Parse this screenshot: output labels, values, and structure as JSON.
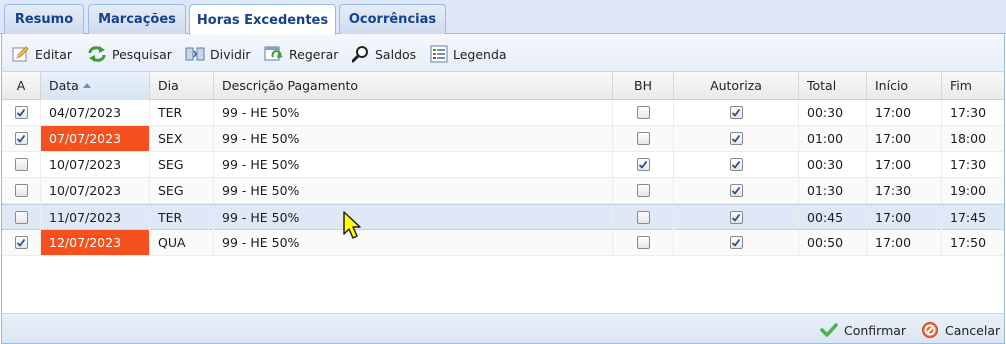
{
  "tabs": [
    {
      "label": "Resumo"
    },
    {
      "label": "Marcações"
    },
    {
      "label": "Horas Excedentes"
    },
    {
      "label": "Ocorrências"
    }
  ],
  "toolbar": {
    "editar": "Editar",
    "pesquisar": "Pesquisar",
    "dividir": "Dividir",
    "regerar": "Regerar",
    "saldos": "Saldos",
    "legenda": "Legenda"
  },
  "grid": {
    "columns": {
      "a": "A",
      "data": "Data",
      "dia": "Dia",
      "descricao": "Descrição Pagamento",
      "bh": "BH",
      "autoriza": "Autoriza",
      "total": "Total",
      "inicio": "Início",
      "fim": "Fim"
    },
    "rows": [
      {
        "a": true,
        "data": "04/07/2023",
        "highlight": false,
        "dia": "TER",
        "descricao": "99 - HE 50%",
        "bh": false,
        "autoriza": true,
        "total": "00:30",
        "inicio": "17:00",
        "fim": "17:30"
      },
      {
        "a": true,
        "data": "07/07/2023",
        "highlight": true,
        "dia": "SEX",
        "descricao": "99 - HE 50%",
        "bh": false,
        "autoriza": true,
        "total": "01:00",
        "inicio": "17:00",
        "fim": "18:00"
      },
      {
        "a": false,
        "data": "10/07/2023",
        "highlight": false,
        "dia": "SEG",
        "descricao": "99 - HE 50%",
        "bh": true,
        "autoriza": true,
        "total": "00:30",
        "inicio": "17:00",
        "fim": "17:30"
      },
      {
        "a": false,
        "data": "10/07/2023",
        "highlight": false,
        "dia": "SEG",
        "descricao": "99 - HE 50%",
        "bh": false,
        "autoriza": true,
        "total": "01:30",
        "inicio": "17:30",
        "fim": "19:00"
      },
      {
        "a": false,
        "data": "11/07/2023",
        "highlight": false,
        "dia": "TER",
        "descricao": "99 - HE 50%",
        "bh": false,
        "autoriza": true,
        "total": "00:45",
        "inicio": "17:00",
        "fim": "17:45"
      },
      {
        "a": true,
        "data": "12/07/2023",
        "highlight": true,
        "dia": "QUA",
        "descricao": "99 - HE 50%",
        "bh": false,
        "autoriza": true,
        "total": "00:50",
        "inicio": "17:00",
        "fim": "17:50"
      }
    ],
    "selected_row": 4
  },
  "footer": {
    "confirmar": "Confirmar",
    "cancelar": "Cancelar"
  },
  "colors": {
    "highlight_date": "#f4511e",
    "accent": "#15428b",
    "selected_row": "#dfe8f6"
  }
}
